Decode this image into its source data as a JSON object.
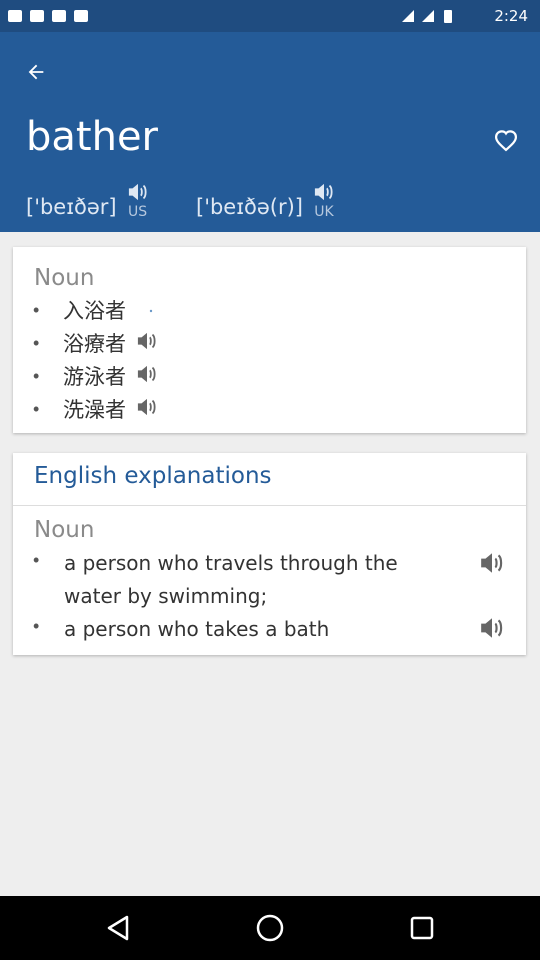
{
  "status_bar": {
    "time": "2:24"
  },
  "header": {
    "word": "bather",
    "back_icon": "arrow-left-icon",
    "favorite_icon": "heart-icon",
    "pronunciations": [
      {
        "ipa": "['beɪðər]",
        "region": "US"
      },
      {
        "ipa": "['beɪðə(r)]",
        "region": "UK"
      }
    ]
  },
  "translations": {
    "part_of_speech": "Noun",
    "items": [
      "入浴者",
      "浴療者",
      "游泳者",
      "洗澡者"
    ],
    "bullet": "•"
  },
  "english": {
    "section_title": "English explanations",
    "part_of_speech": "Noun",
    "items": [
      {
        "line1": "a person who travels through the",
        "line2": "water by swimming;"
      },
      {
        "line1": "a person who takes a bath"
      }
    ]
  },
  "colors": {
    "appbar": "#245b98",
    "statusbar": "#1f4c80",
    "accent": "#245b98",
    "background": "#eeeeee"
  }
}
